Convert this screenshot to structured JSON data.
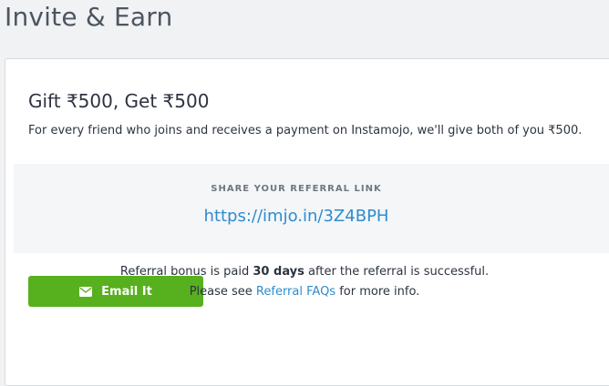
{
  "page": {
    "title": "Invite & Earn"
  },
  "offer": {
    "title": "Gift ₹500, Get ₹500",
    "description": "For every friend who joins and receives a payment on Instamojo, we'll give both of you ₹500."
  },
  "share": {
    "label": "SHARE YOUR REFERRAL LINK",
    "link": "https://imjo.in/3Z4BPH"
  },
  "email_button": {
    "label": "Email It",
    "icon": "envelope-icon"
  },
  "footer": {
    "line1_before": "Referral bonus is paid ",
    "line1_bold": "30 days",
    "line1_after": " after the referral is successful.",
    "line2_before": "Please see ",
    "line2_link": "Referral FAQs",
    "line2_after": " for more info."
  },
  "colors": {
    "accent_green": "#57b01d",
    "link_blue": "#2e8ccf",
    "text_dark": "#2c3440"
  }
}
